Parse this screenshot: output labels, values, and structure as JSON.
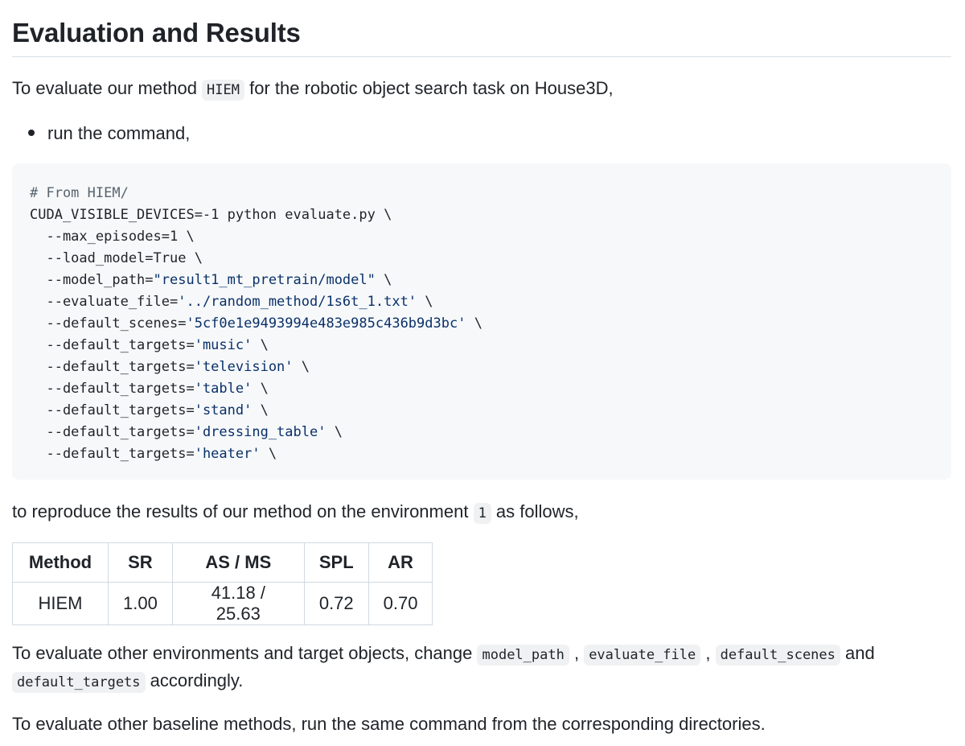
{
  "heading": "Evaluation and Results",
  "intro": {
    "before": "To evaluate our method ",
    "method_code": "HIEM",
    "after": " for the robotic object search task on House3D,"
  },
  "bullet": "run the command,",
  "code_lines": [
    {
      "segments": [
        {
          "t": "# From HIEM/",
          "k": "comment"
        }
      ]
    },
    {
      "segments": [
        {
          "t": "CUDA_VISIBLE_DEVICES=-1 python evaluate.py \\",
          "k": "plain"
        }
      ]
    },
    {
      "segments": [
        {
          "t": "  --max_episodes=1 \\",
          "k": "plain"
        }
      ]
    },
    {
      "segments": [
        {
          "t": "  --load_model=True \\",
          "k": "plain"
        }
      ]
    },
    {
      "segments": [
        {
          "t": "  --model_path=",
          "k": "plain"
        },
        {
          "t": "\"result1_mt_pretrain/model\"",
          "k": "str"
        },
        {
          "t": " \\",
          "k": "plain"
        }
      ]
    },
    {
      "segments": [
        {
          "t": "  --evaluate_file=",
          "k": "plain"
        },
        {
          "t": "'../random_method/1s6t_1.txt'",
          "k": "str"
        },
        {
          "t": " \\",
          "k": "plain"
        }
      ]
    },
    {
      "segments": [
        {
          "t": "  --default_scenes=",
          "k": "plain"
        },
        {
          "t": "'5cf0e1e9493994e483e985c436b9d3bc'",
          "k": "str"
        },
        {
          "t": " \\",
          "k": "plain"
        }
      ]
    },
    {
      "segments": [
        {
          "t": "  --default_targets=",
          "k": "plain"
        },
        {
          "t": "'music'",
          "k": "str"
        },
        {
          "t": " \\",
          "k": "plain"
        }
      ]
    },
    {
      "segments": [
        {
          "t": "  --default_targets=",
          "k": "plain"
        },
        {
          "t": "'television'",
          "k": "str"
        },
        {
          "t": " \\",
          "k": "plain"
        }
      ]
    },
    {
      "segments": [
        {
          "t": "  --default_targets=",
          "k": "plain"
        },
        {
          "t": "'table'",
          "k": "str"
        },
        {
          "t": " \\",
          "k": "plain"
        }
      ]
    },
    {
      "segments": [
        {
          "t": "  --default_targets=",
          "k": "plain"
        },
        {
          "t": "'stand'",
          "k": "str"
        },
        {
          "t": " \\",
          "k": "plain"
        }
      ]
    },
    {
      "segments": [
        {
          "t": "  --default_targets=",
          "k": "plain"
        },
        {
          "t": "'dressing_table'",
          "k": "str"
        },
        {
          "t": " \\",
          "k": "plain"
        }
      ]
    },
    {
      "segments": [
        {
          "t": "  --default_targets=",
          "k": "plain"
        },
        {
          "t": "'heater'",
          "k": "str"
        },
        {
          "t": " \\",
          "k": "plain"
        }
      ]
    }
  ],
  "reproduce": {
    "before": "to reproduce the results of our method on the environment ",
    "env_code": "1",
    "after": " as follows,"
  },
  "table": {
    "headers": [
      "Method",
      "SR",
      "AS / MS",
      "SPL",
      "AR"
    ],
    "rows": [
      [
        "HIEM",
        "1.00",
        "41.18 / 25.63",
        "0.72",
        "0.70"
      ]
    ]
  },
  "other_envs": {
    "before": "To evaluate other environments and target objects, change ",
    "code1": "model_path",
    "sep1": " , ",
    "code2": "evaluate_file",
    "sep2": " , ",
    "code3": "default_scenes",
    "and": " and",
    "code4": "default_targets",
    "after": " accordingly."
  },
  "baselines": "To evaluate other baseline methods, run the same command from the corresponding directories.",
  "colors": {
    "text": "#1f2328",
    "code_bg": "#f6f8fa",
    "inline_code_bg": "#eff1f3",
    "string": "#0a3069",
    "comment": "#59636e",
    "border": "#d1d9e0"
  }
}
